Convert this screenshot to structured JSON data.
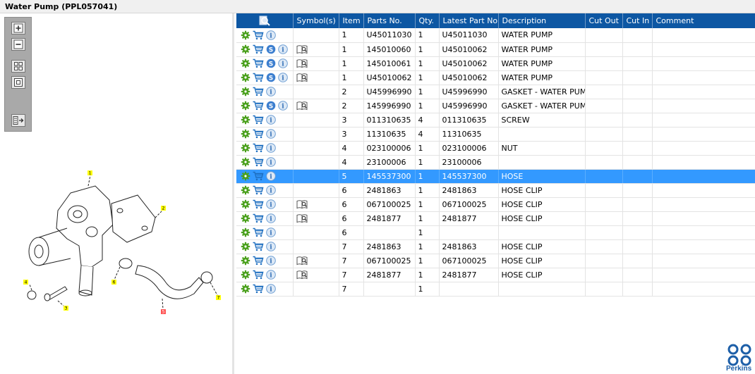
{
  "window": {
    "title": "Water Pump (PPL057041)"
  },
  "colors": {
    "header_bg": "#0d57a3",
    "selected_bg": "#3399ff",
    "gear": "#4aa01c",
    "cart": "#1e6fc0",
    "badge": "#3d7fcf",
    "logo": "#1d5fa8"
  },
  "toolbox": {
    "items": [
      {
        "name": "zoom-in-icon"
      },
      {
        "name": "zoom-out-icon"
      },
      {
        "name": "fit-all-icon"
      },
      {
        "name": "fit-window-icon"
      },
      {
        "name": "toggle-list-icon"
      }
    ]
  },
  "diagram": {
    "callouts": [
      "1",
      "2",
      "3",
      "4",
      "5",
      "6",
      "7"
    ]
  },
  "table": {
    "columns": [
      "",
      "Symbol(s)",
      "Item",
      "Parts No.",
      "Qty.",
      "Latest Part No.",
      "Description",
      "Cut Out",
      "Cut In",
      "Comment"
    ],
    "rows": [
      {
        "s": false,
        "sym": false,
        "item": "1",
        "part": "U45011030",
        "qty": "1",
        "latest": "U45011030",
        "desc": "WATER PUMP",
        "selected": false
      },
      {
        "s": true,
        "sym": true,
        "item": "1",
        "part": "145010060",
        "qty": "1",
        "latest": "U45010062",
        "desc": "WATER PUMP",
        "selected": false
      },
      {
        "s": true,
        "sym": true,
        "item": "1",
        "part": "145010061",
        "qty": "1",
        "latest": "U45010062",
        "desc": "WATER PUMP",
        "selected": false
      },
      {
        "s": true,
        "sym": true,
        "item": "1",
        "part": "U45010062",
        "qty": "1",
        "latest": "U45010062",
        "desc": "WATER PUMP",
        "selected": false
      },
      {
        "s": false,
        "sym": false,
        "item": "2",
        "part": "U45996990",
        "qty": "1",
        "latest": "U45996990",
        "desc": "GASKET - WATER PUMP",
        "selected": false
      },
      {
        "s": true,
        "sym": true,
        "item": "2",
        "part": "145996990",
        "qty": "1",
        "latest": "U45996990",
        "desc": "GASKET - WATER PUMP",
        "selected": false
      },
      {
        "s": false,
        "sym": false,
        "item": "3",
        "part": "011310635",
        "qty": "4",
        "latest": "011310635",
        "desc": "SCREW",
        "selected": false
      },
      {
        "s": false,
        "sym": false,
        "item": "3",
        "part": "11310635",
        "qty": "4",
        "latest": "11310635",
        "desc": "",
        "selected": false
      },
      {
        "s": false,
        "sym": false,
        "item": "4",
        "part": "023100006",
        "qty": "1",
        "latest": "023100006",
        "desc": "NUT",
        "selected": false
      },
      {
        "s": false,
        "sym": false,
        "item": "4",
        "part": "23100006",
        "qty": "1",
        "latest": "23100006",
        "desc": "",
        "selected": false
      },
      {
        "s": false,
        "sym": false,
        "item": "5",
        "part": "145537300",
        "qty": "1",
        "latest": "145537300",
        "desc": "HOSE",
        "selected": true
      },
      {
        "s": false,
        "sym": false,
        "item": "6",
        "part": "2481863",
        "qty": "1",
        "latest": "2481863",
        "desc": "HOSE CLIP",
        "selected": false
      },
      {
        "s": false,
        "sym": true,
        "item": "6",
        "part": "067100025",
        "qty": "1",
        "latest": "067100025",
        "desc": "HOSE CLIP",
        "selected": false
      },
      {
        "s": false,
        "sym": true,
        "item": "6",
        "part": "2481877",
        "qty": "1",
        "latest": "2481877",
        "desc": "HOSE CLIP",
        "selected": false
      },
      {
        "s": false,
        "sym": false,
        "item": "6",
        "part": "",
        "qty": "1",
        "latest": "",
        "desc": "",
        "selected": false
      },
      {
        "s": false,
        "sym": false,
        "item": "7",
        "part": "2481863",
        "qty": "1",
        "latest": "2481863",
        "desc": "HOSE CLIP",
        "selected": false
      },
      {
        "s": false,
        "sym": true,
        "item": "7",
        "part": "067100025",
        "qty": "1",
        "latest": "067100025",
        "desc": "HOSE CLIP",
        "selected": false
      },
      {
        "s": false,
        "sym": true,
        "item": "7",
        "part": "2481877",
        "qty": "1",
        "latest": "2481877",
        "desc": "HOSE CLIP",
        "selected": false
      },
      {
        "s": false,
        "sym": false,
        "item": "7",
        "part": "",
        "qty": "1",
        "latest": "",
        "desc": "",
        "selected": false
      }
    ]
  },
  "brand": {
    "name": "Perkins"
  }
}
